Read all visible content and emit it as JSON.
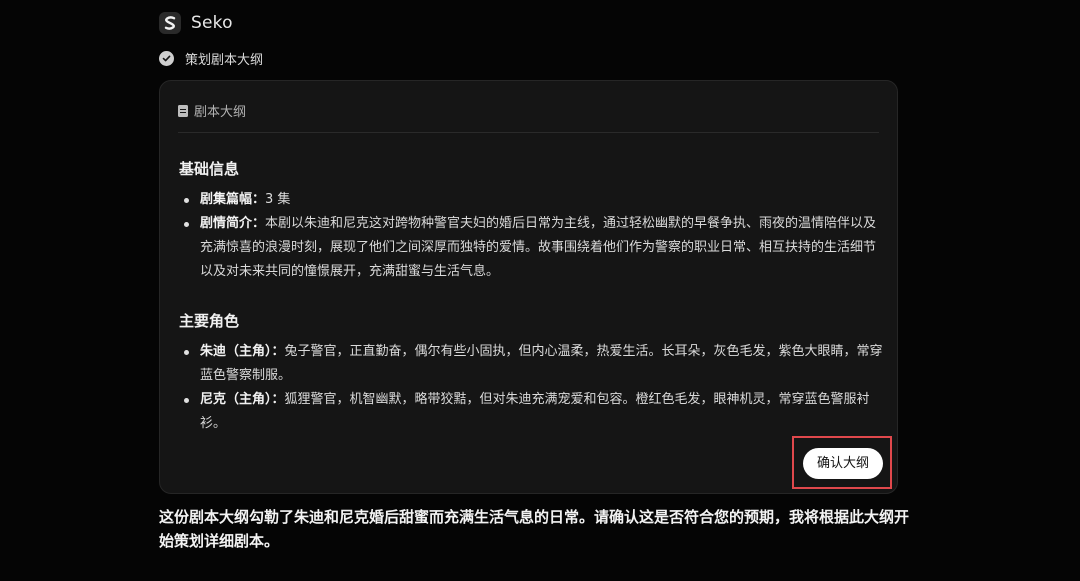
{
  "header": {
    "app_name": "Seko",
    "logo_icon": "seko-logo-icon"
  },
  "step": {
    "label": "策划剧本大纲",
    "status_icon": "check-circle-icon"
  },
  "card": {
    "title": "剧本大纲",
    "title_icon": "document-icon",
    "sections": [
      {
        "title": "基础信息",
        "items": [
          {
            "label": "剧集篇幅：",
            "text": "3 集"
          },
          {
            "label": "剧情简介：",
            "text": "本剧以朱迪和尼克这对跨物种警官夫妇的婚后日常为主线，通过轻松幽默的早餐争执、雨夜的温情陪伴以及充满惊喜的浪漫时刻，展现了他们之间深厚而独特的爱情。故事围绕着他们作为警察的职业日常、相互扶持的生活细节以及对未来共同的憧憬展开，充满甜蜜与生活气息。"
          }
        ]
      },
      {
        "title": "主要角色",
        "items": [
          {
            "label": "朱迪（主角）：",
            "text": "兔子警官，正直勤奋，偶尔有些小固执，但内心温柔，热爱生活。长耳朵，灰色毛发，紫色大眼睛，常穿蓝色警察制服。"
          },
          {
            "label": "尼克（主角）：",
            "text": "狐狸警官，机智幽默，略带狡黠，但对朱迪充满宠爱和包容。橙红色毛发，眼神机灵，常穿蓝色警服衬衫。"
          }
        ]
      }
    ],
    "confirm_label": "确认大纲"
  },
  "message": "这份剧本大纲勾勒了朱迪和尼克婚后甜蜜而充满生活气息的日常。请确认这是否符合您的预期，我将根据此大纲开始策划详细剧本。",
  "colors": {
    "background": "#050505",
    "card": "#151515",
    "highlight": "#e0484c",
    "button": "#ffffff"
  }
}
